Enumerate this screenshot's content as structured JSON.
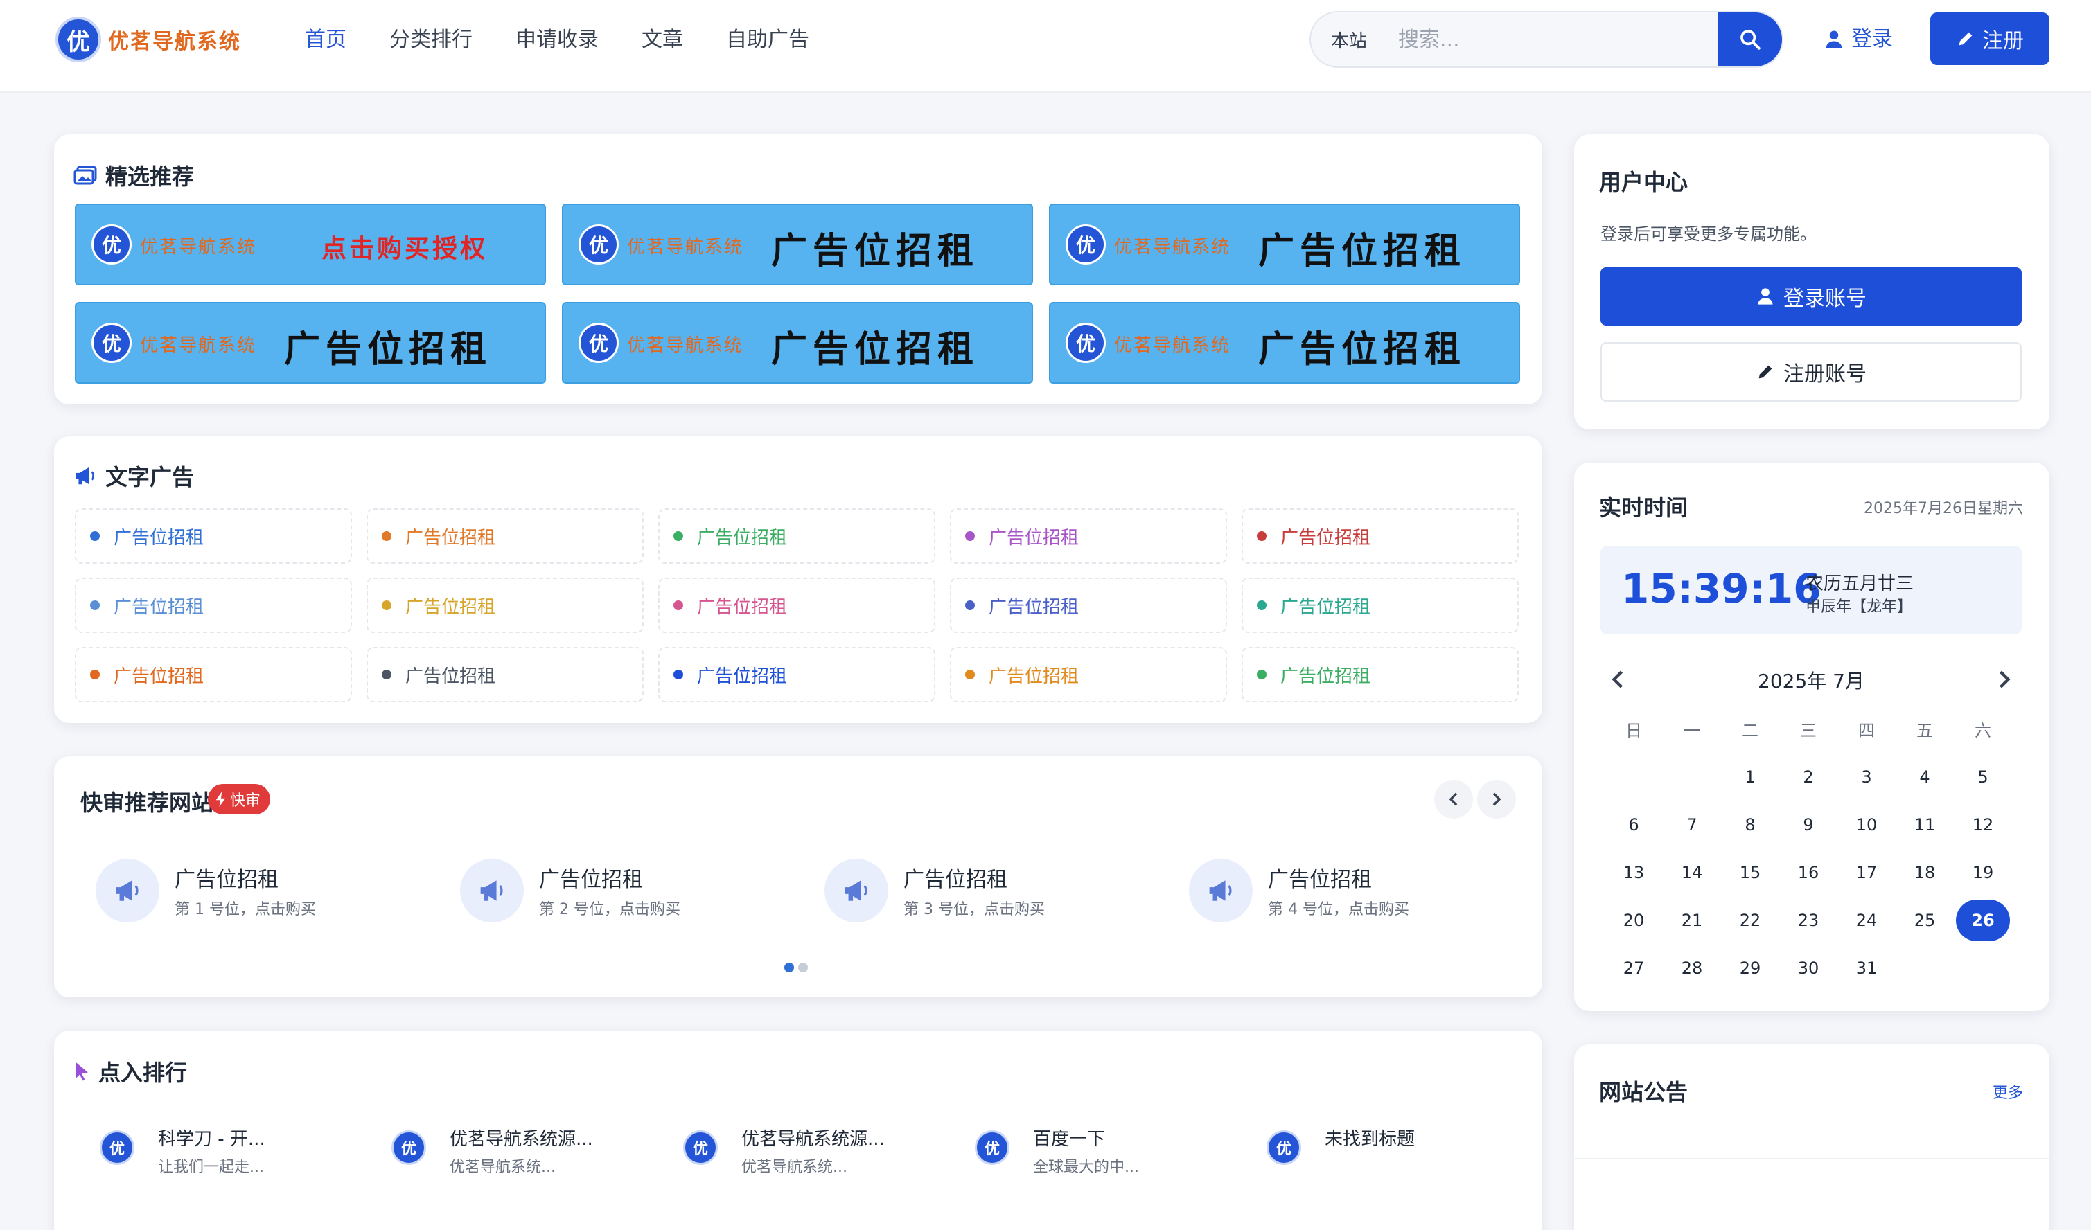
{
  "brand": {
    "badge": "优",
    "name": "优茗导航系统"
  },
  "nav": [
    "首页",
    "分类排行",
    "申请收录",
    "文章",
    "自助广告"
  ],
  "search": {
    "scope": "本站",
    "placeholder": "搜索..."
  },
  "header": {
    "login": "登录",
    "register": "注册"
  },
  "featured": {
    "title": "精选推荐",
    "banners": [
      {
        "brand": "优茗导航系统",
        "slogan": "点击购买授权",
        "highlight": true
      },
      {
        "brand": "优茗导航系统",
        "slogan": "广告位招租",
        "highlight": false
      },
      {
        "brand": "优茗导航系统",
        "slogan": "广告位招租",
        "highlight": false
      },
      {
        "brand": "优茗导航系统",
        "slogan": "广告位招租",
        "highlight": false
      },
      {
        "brand": "优茗导航系统",
        "slogan": "广告位招租",
        "highlight": false
      },
      {
        "brand": "优茗导航系统",
        "slogan": "广告位招租",
        "highlight": false
      }
    ]
  },
  "text_ads": {
    "title": "文字广告",
    "items": [
      {
        "label": "广告位招租",
        "color": "#2f6fd6"
      },
      {
        "label": "广告位招租",
        "color": "#e07a2a"
      },
      {
        "label": "广告位招租",
        "color": "#3cae63"
      },
      {
        "label": "广告位招租",
        "color": "#a855c8"
      },
      {
        "label": "广告位招租",
        "color": "#c83c3c"
      },
      {
        "label": "广告位招租",
        "color": "#5a8fd6"
      },
      {
        "label": "广告位招租",
        "color": "#d6a52a"
      },
      {
        "label": "广告位招租",
        "color": "#d6558f"
      },
      {
        "label": "广告位招租",
        "color": "#4a5fc8"
      },
      {
        "label": "广告位招租",
        "color": "#2aa890"
      },
      {
        "label": "广告位招租",
        "color": "#e0691f"
      },
      {
        "label": "广告位招租",
        "color": "#4b5563"
      },
      {
        "label": "广告位招租",
        "color": "#1e4fd8"
      },
      {
        "label": "广告位招租",
        "color": "#e08a1f"
      },
      {
        "label": "广告位招租",
        "color": "#3cae63"
      }
    ]
  },
  "fast_review": {
    "title": "快审推荐网站",
    "badge": "快审",
    "items": [
      {
        "name": "广告位招租",
        "sub": "第 1 号位，点击购买"
      },
      {
        "name": "广告位招租",
        "sub": "第 2 号位，点击购买"
      },
      {
        "name": "广告位招租",
        "sub": "第 3 号位，点击购买"
      },
      {
        "name": "广告位招租",
        "sub": "第 4 号位，点击购买"
      }
    ]
  },
  "click_rank": {
    "title": "点入排行",
    "items": [
      {
        "badge": "优",
        "name": "科学刀 - 开...",
        "desc": "让我们一起走..."
      },
      {
        "badge": "优",
        "name": "优茗导航系统源...",
        "desc": "优茗导航系统..."
      },
      {
        "badge": "优",
        "name": "优茗导航系统源...",
        "desc": "优茗导航系统..."
      },
      {
        "badge": "优",
        "name": "百度一下",
        "desc": "全球最大的中..."
      },
      {
        "badge": "优",
        "name": "未找到标题",
        "desc": ""
      }
    ]
  },
  "user_center": {
    "title": "用户中心",
    "desc": "登录后可享受更多专属功能。",
    "login_btn": "登录账号",
    "register_btn": "注册账号"
  },
  "clock": {
    "title": "实时时间",
    "date": "2025年7月26日星期六",
    "time": "15:39:16",
    "lunar": "农历五月廿三",
    "ganzhi": "甲辰年【龙年】"
  },
  "calendar": {
    "month": "2025年 7月",
    "weekdays": [
      "日",
      "一",
      "二",
      "三",
      "四",
      "五",
      "六"
    ],
    "weeks": [
      [
        "",
        "",
        "1",
        "2",
        "3",
        "4",
        "5"
      ],
      [
        "6",
        "7",
        "8",
        "9",
        "10",
        "11",
        "12"
      ],
      [
        "13",
        "14",
        "15",
        "16",
        "17",
        "18",
        "19"
      ],
      [
        "20",
        "21",
        "22",
        "23",
        "24",
        "25",
        "26"
      ],
      [
        "27",
        "28",
        "29",
        "30",
        "31",
        "",
        ""
      ]
    ],
    "today": "26"
  },
  "notice": {
    "title": "网站公告",
    "more": "更多"
  },
  "colors": {
    "primary": "#1e4fd8",
    "banner": "#56b3f0",
    "accent": "#e0691f"
  }
}
